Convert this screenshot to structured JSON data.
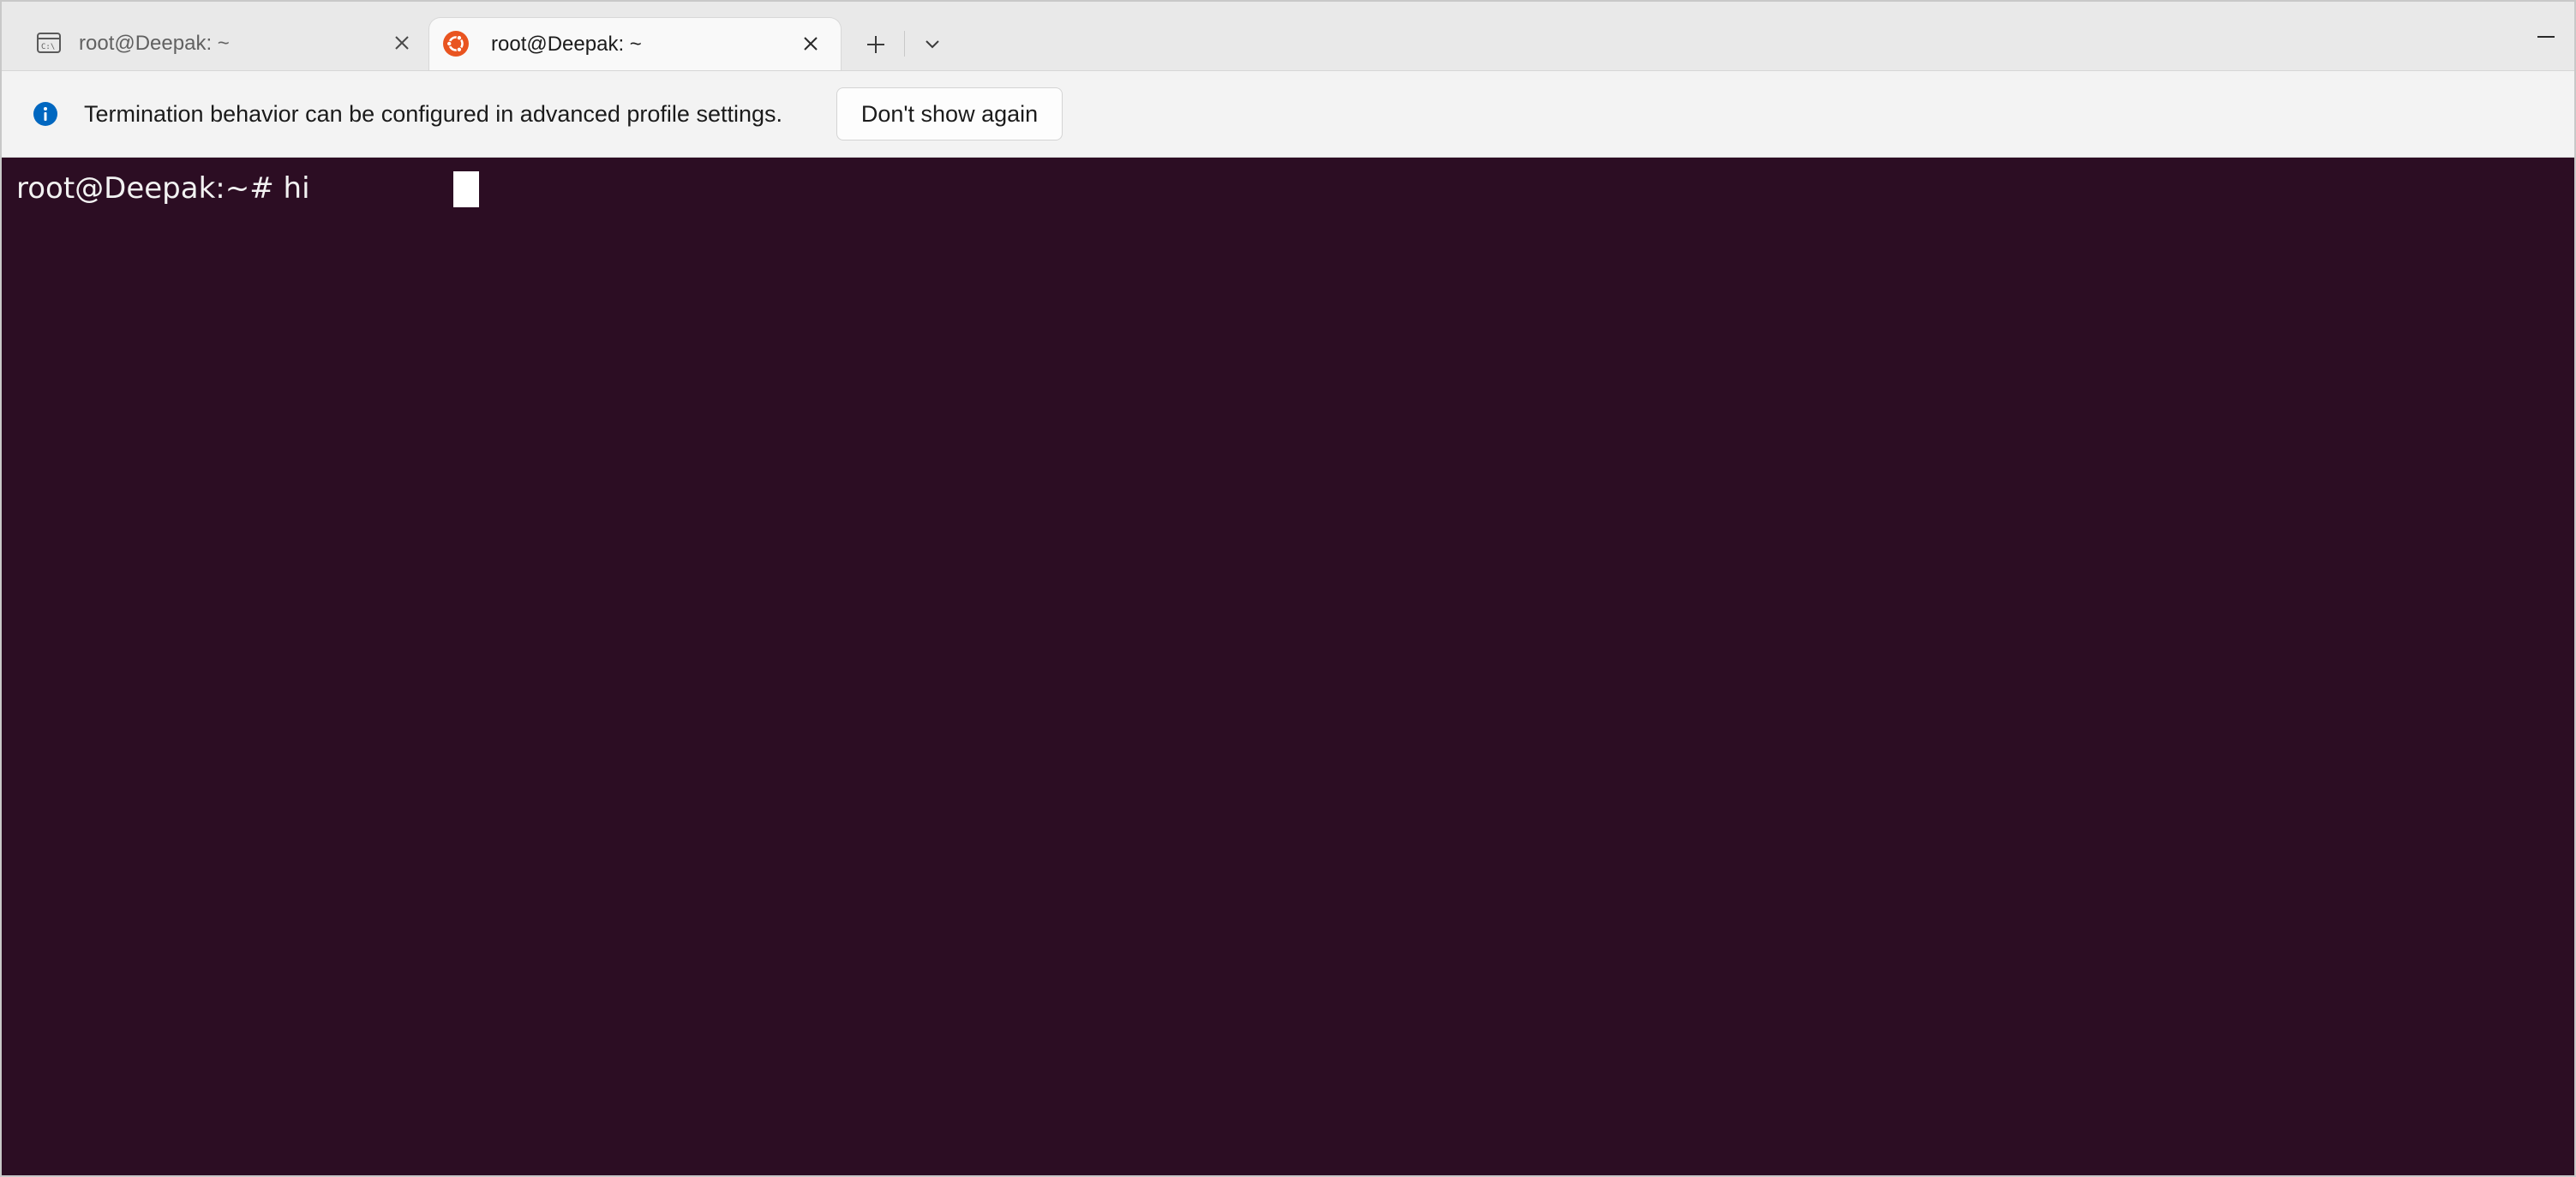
{
  "tabs": [
    {
      "label": "root@Deepak: ~",
      "icon": "command-prompt-icon",
      "active": false
    },
    {
      "label": "root@Deepak: ~",
      "icon": "ubuntu-icon",
      "active": true
    }
  ],
  "tabbar": {
    "new_tab_icon": "plus-icon",
    "dropdown_icon": "chevron-down-icon",
    "minimize_icon": "minimize-icon"
  },
  "infobar": {
    "icon": "info-icon",
    "message": "Termination behavior can be configured in advanced profile settings.",
    "action_label": "Don't show again"
  },
  "terminal": {
    "prompt": "root@Deepak:~#",
    "command": "hi",
    "background": "#2c0d23",
    "foreground": "#f2f2f2"
  },
  "colors": {
    "ubuntu_orange": "#e95420",
    "info_blue": "#0067c0",
    "tabbar_bg": "#e9e9e9",
    "active_tab_bg": "#f9f9f9"
  }
}
